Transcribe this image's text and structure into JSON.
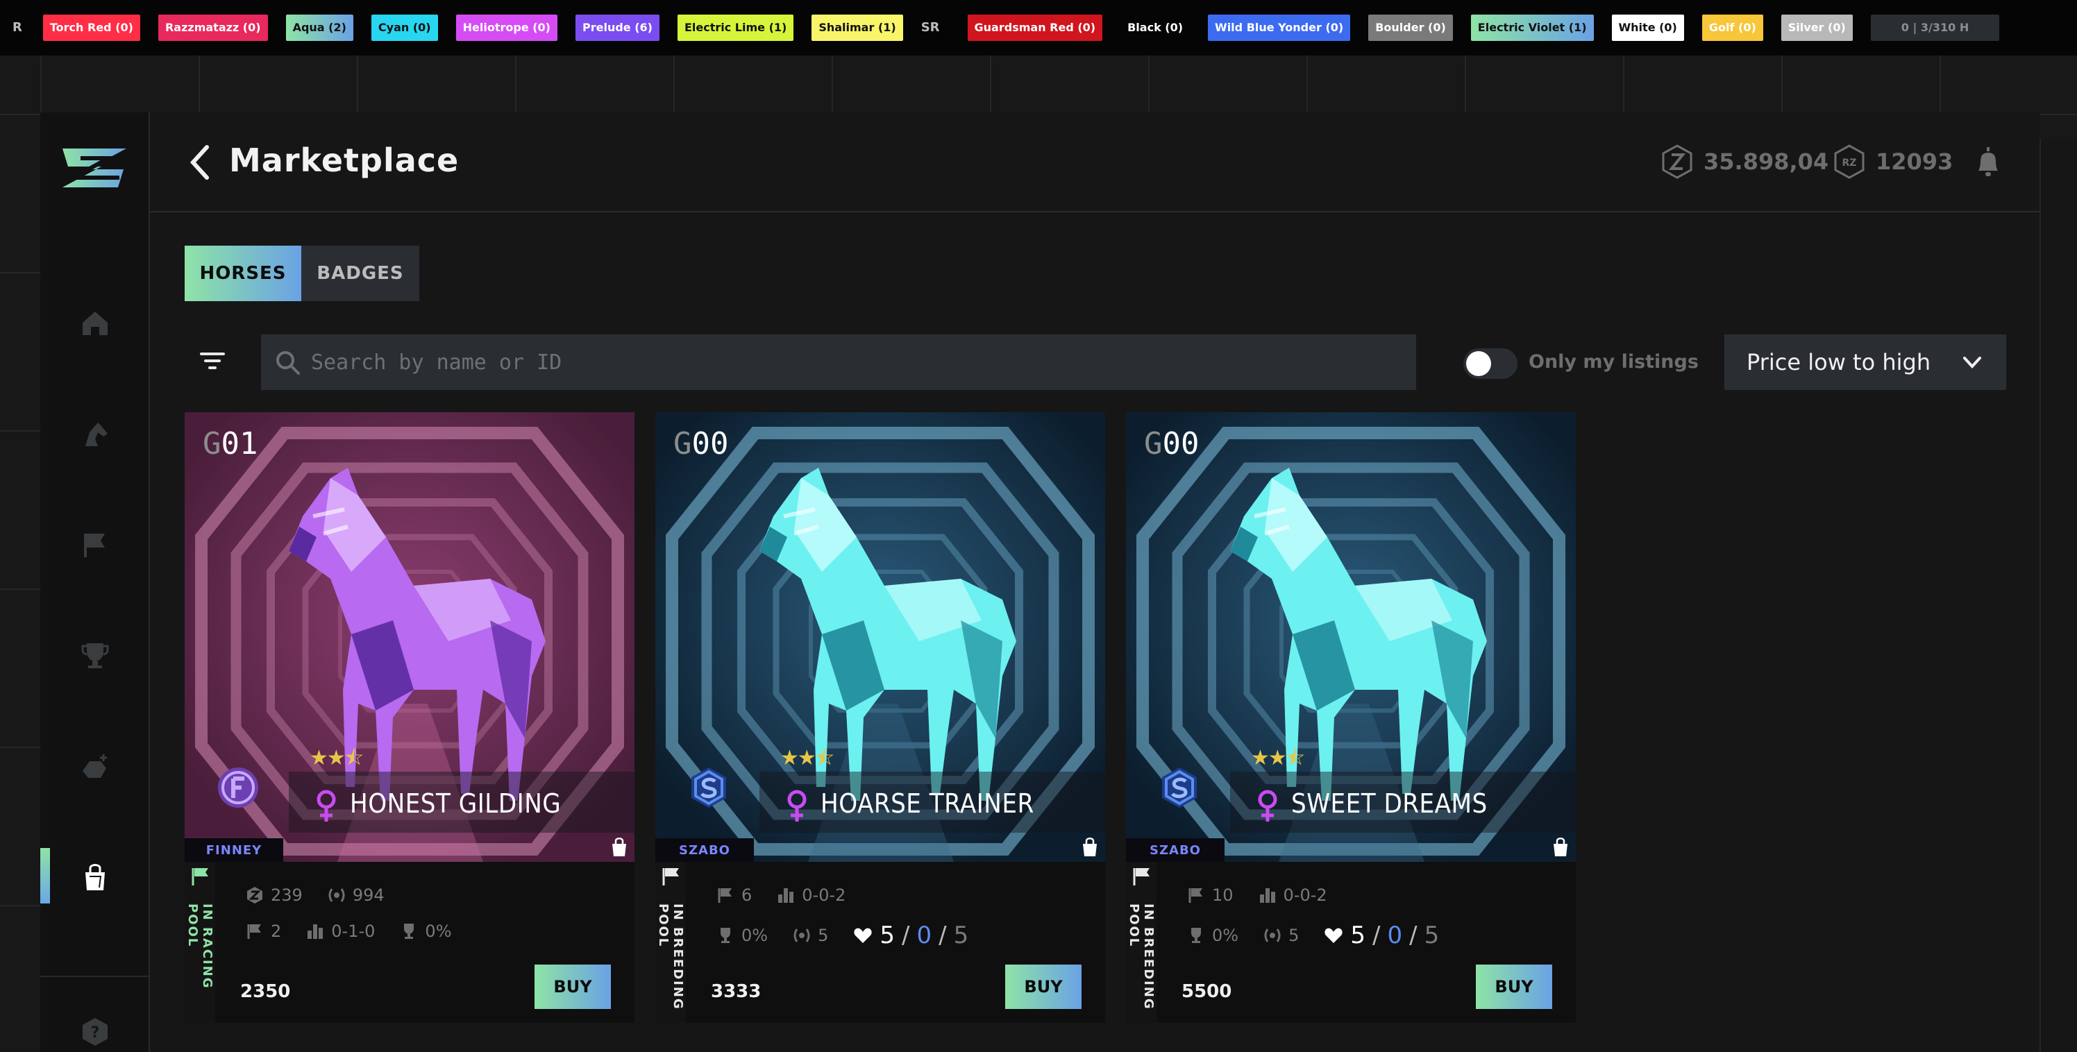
{
  "topbar": {
    "leading": "R",
    "tags": [
      {
        "label": "Torch Red (0)",
        "bg": "#ff2d46",
        "fg": "#ffffff"
      },
      {
        "label": "Razzmatazz (0)",
        "bg": "#e8295d",
        "fg": "#ffffff"
      },
      {
        "label": "Aqua (2)",
        "bg": "linear-gradient(90deg,#8ee3a6,#6aa2e4)",
        "fg": "#111111"
      },
      {
        "label": "Cyan (0)",
        "bg": "#28d6f0",
        "fg": "#111111"
      },
      {
        "label": "Heliotrope (0)",
        "bg": "#d64cf4",
        "fg": "#ffffff"
      },
      {
        "label": "Prelude (6)",
        "bg": "#7b4df0",
        "fg": "#ffffff"
      },
      {
        "label": "Electric Lime (1)",
        "bg": "#d6f53a",
        "fg": "#111111"
      },
      {
        "label": "Shalimar (1)",
        "bg": "#f8f56a",
        "fg": "#111111"
      },
      {
        "label": "SR",
        "bg": "transparent",
        "fg": "#bdbdbd",
        "plain": true
      },
      {
        "label": "Guardsman Red (0)",
        "bg": "#d0151e",
        "fg": "#ffffff"
      },
      {
        "label": "Black (0)",
        "bg": "#050505",
        "fg": "#ffffff"
      },
      {
        "label": "Wild Blue Yonder (0)",
        "bg": "#3d6bf0",
        "fg": "#ffffff"
      },
      {
        "label": "Boulder (0)",
        "bg": "#7a7a7a",
        "fg": "#ffffff"
      },
      {
        "label": "Electric Violet (1)",
        "bg": "linear-gradient(90deg,#8ee3a6,#6aa2e4)",
        "fg": "#111111"
      },
      {
        "label": "White (0)",
        "bg": "#ffffff",
        "fg": "#111111"
      },
      {
        "label": "Golf (0)",
        "bg": "#f8c63a",
        "fg": "#ffffff"
      },
      {
        "label": "Silver (0)",
        "bg": "#b8b8b8",
        "fg": "#ffffff"
      }
    ],
    "counter": "0 | 3/310 H"
  },
  "header": {
    "title": "Marketplace",
    "balance_zed": "35.898,04",
    "balance_rz": "12093"
  },
  "tabs": [
    "HORSES",
    "BADGES"
  ],
  "filters": {
    "search_placeholder": "Search by name or ID",
    "only_my_listings": "Only my listings",
    "sort_selected": "Price low to high"
  },
  "cards": [
    {
      "gen_prefix": "G",
      "gen_number": "01",
      "name": "HONEST GILDING",
      "stars": 2.5,
      "stable": "FINNEY",
      "pool": "IN RACING POOL",
      "pool_color": "#8ee3a6",
      "stat_zed": "239",
      "stat_laurel": "994",
      "stat_races": "2",
      "stat_record": "0-1-0",
      "stat_win": "0%",
      "price": "2350",
      "buy": "BUY",
      "theme": "purple"
    },
    {
      "gen_prefix": "G",
      "gen_number": "00",
      "name": "HOARSE TRAINER",
      "stars": 2.5,
      "stable": "SZABO",
      "pool": "IN BREEDING POOL",
      "pool_color": "#e8e8e8",
      "stat_races": "6",
      "stat_record": "0-0-2",
      "stat_win": "0%",
      "stat_laurel": "5",
      "breed_a": "5",
      "breed_b": "0",
      "breed_c": "5",
      "price": "3333",
      "buy": "BUY",
      "theme": "cyan"
    },
    {
      "gen_prefix": "G",
      "gen_number": "00",
      "name": "SWEET DREAMS",
      "stars": 2.5,
      "stable": "SZABO",
      "pool": "IN BREEDING POOL",
      "pool_color": "#e8e8e8",
      "stat_races": "10",
      "stat_record": "0-0-2",
      "stat_win": "0%",
      "stat_laurel": "5",
      "breed_a": "5",
      "breed_b": "0",
      "breed_c": "5",
      "price": "5500",
      "buy": "BUY",
      "theme": "cyan"
    }
  ]
}
